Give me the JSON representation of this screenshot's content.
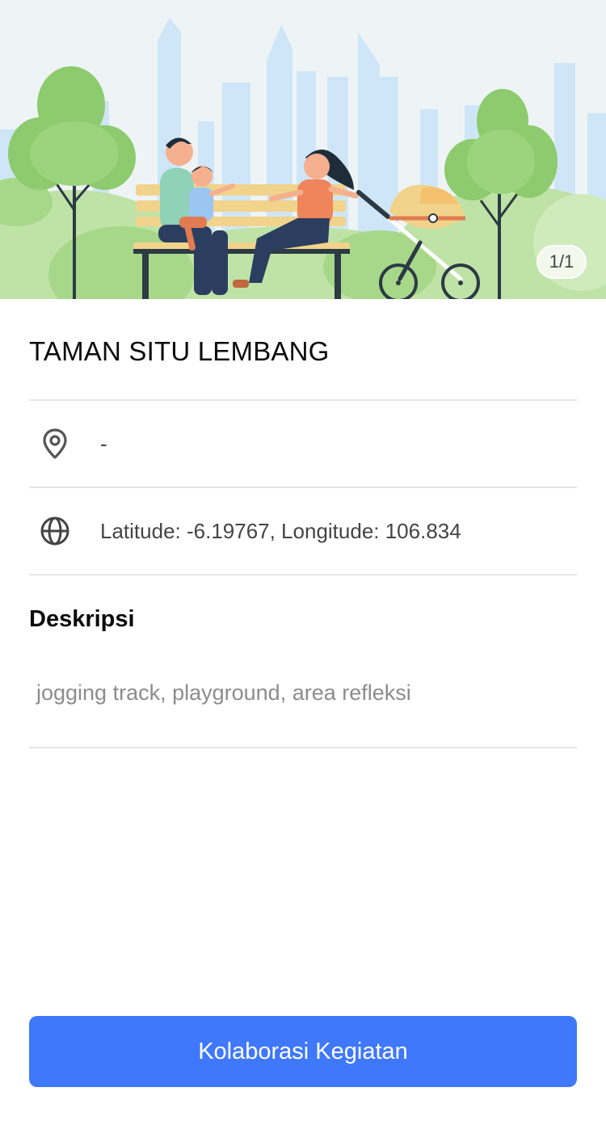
{
  "place": {
    "name": "TAMAN SITU LEMBANG",
    "address": "-",
    "coordinates": "Latitude: -6.19767, Longitude: 106.834"
  },
  "gallery": {
    "counter": "1/1",
    "image": "park-family-illustration"
  },
  "description": {
    "heading": "Deskripsi",
    "text": "jogging track, playground, area refleksi"
  },
  "actions": {
    "collaborate_label": "Kolaborasi Kegiatan"
  },
  "icons": {
    "address": "location-pin-icon",
    "coordinates": "globe-icon"
  },
  "colors": {
    "primary": "#3f78fb",
    "divider": "#e6e6e6",
    "muted_text": "#8c8c8c"
  }
}
